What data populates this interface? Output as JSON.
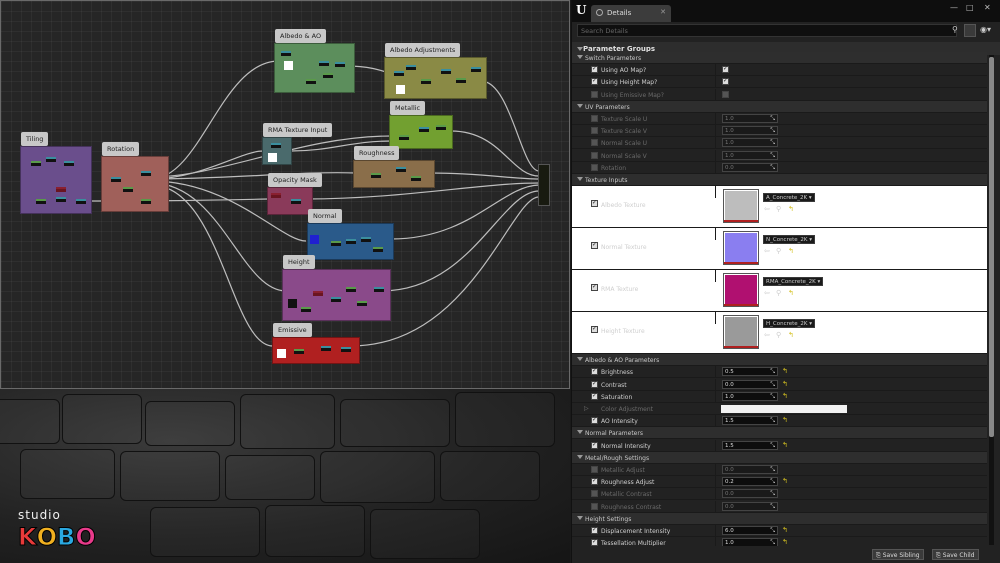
{
  "graph": {
    "comments": [
      {
        "label": "Albedo & AO",
        "color": "#5c8e5c"
      },
      {
        "label": "Albedo Adjustments",
        "color": "#8a8a45"
      },
      {
        "label": "Tiling",
        "color": "#6a4e8c"
      },
      {
        "label": "Rotation",
        "color": "#a0605a"
      },
      {
        "label": "RMA Texture Input",
        "color": "#4a6a6c"
      },
      {
        "label": "Metallic",
        "color": "#72a030"
      },
      {
        "label": "Roughness",
        "color": "#8a6e4a"
      },
      {
        "label": "Opacity Mask",
        "color": "#8a3a5a"
      },
      {
        "label": "Normal",
        "color": "#2a5a8a"
      },
      {
        "label": "Height",
        "color": "#8a4a8a"
      },
      {
        "label": "Emissive",
        "color": "#b02020"
      }
    ]
  },
  "logo": {
    "top": "studio",
    "letters": [
      "K",
      "O",
      "B",
      "O"
    ],
    "colors": [
      "#e83a3a",
      "#f0b020",
      "#2aa8e0",
      "#e83a8a"
    ]
  },
  "panel": {
    "tab_label": "Details",
    "search_placeholder": "Search Details",
    "root_label": "Parameter Groups",
    "footer": {
      "save_sibling": "Save Sibling",
      "save_child": "Save Child"
    },
    "rows": [
      {
        "kind": "cat",
        "label": "Switch Parameters"
      },
      {
        "kind": "bool",
        "label": "Using AO Map?",
        "on": true,
        "value": true,
        "dim": false
      },
      {
        "kind": "bool",
        "label": "Using Height Map?",
        "on": true,
        "value": true,
        "dim": false
      },
      {
        "kind": "bool",
        "label": "Using Emissive Map?",
        "on": false,
        "value": false,
        "dim": true
      },
      {
        "kind": "cat",
        "label": "UV Parameters"
      },
      {
        "kind": "num",
        "label": "Texture Scale U",
        "value": "1.0",
        "dim": true
      },
      {
        "kind": "num",
        "label": "Texture Scale V",
        "value": "1.0",
        "dim": true
      },
      {
        "kind": "num",
        "label": "Normal Scale U",
        "value": "1.0",
        "dim": true
      },
      {
        "kind": "num",
        "label": "Normal Scale V",
        "value": "1.0",
        "dim": true
      },
      {
        "kind": "num",
        "label": "Rotation",
        "value": "0.0",
        "dim": true
      },
      {
        "kind": "cat",
        "label": "Texture Inputs"
      },
      {
        "kind": "tex",
        "label": "Albedo Texture",
        "asset": "A_Concrete_2K",
        "color": "#bdbdbd"
      },
      {
        "kind": "tex",
        "label": "Normal Texture",
        "asset": "N_Concrete_2K",
        "color": "#8a7ef0"
      },
      {
        "kind": "tex",
        "label": "RMA Texture",
        "asset": "RMA_Concrete_2K",
        "color": "#b01070"
      },
      {
        "kind": "tex",
        "label": "Height Texture",
        "asset": "H_Concrete_2K",
        "color": "#9a9a9a"
      },
      {
        "kind": "cat",
        "label": "Albedo & AO Parameters"
      },
      {
        "kind": "num",
        "label": "Brightness",
        "value": "0.5",
        "dim": false,
        "reset": true
      },
      {
        "kind": "num",
        "label": "Contrast",
        "value": "0.0",
        "dim": false,
        "reset": true
      },
      {
        "kind": "num",
        "label": "Saturation",
        "value": "1.0",
        "dim": false,
        "reset": true
      },
      {
        "kind": "color",
        "label": "Color Adjustment",
        "dim": true
      },
      {
        "kind": "num",
        "label": "AO Intensity",
        "value": "1.5",
        "dim": false,
        "reset": true
      },
      {
        "kind": "cat",
        "label": "Normal Parameters"
      },
      {
        "kind": "num",
        "label": "Normal Intensity",
        "value": "1.5",
        "dim": false,
        "reset": true
      },
      {
        "kind": "cat",
        "label": "Metal/Rough Settings"
      },
      {
        "kind": "num",
        "label": "Metallic Adjust",
        "value": "0.0",
        "dim": true
      },
      {
        "kind": "num",
        "label": "Roughness Adjust",
        "value": "0.2",
        "dim": false,
        "reset": true
      },
      {
        "kind": "num",
        "label": "Metallic Contrast",
        "value": "0.0",
        "dim": true
      },
      {
        "kind": "num",
        "label": "Roughness Contrast",
        "value": "0.0",
        "dim": true
      },
      {
        "kind": "cat",
        "label": "Height Settings"
      },
      {
        "kind": "num",
        "label": "Displacement Intensity",
        "value": "6.0",
        "dim": false,
        "reset": true
      },
      {
        "kind": "num",
        "label": "Tessellation Multiplier",
        "value": "1.0",
        "dim": false,
        "reset": true
      }
    ]
  }
}
